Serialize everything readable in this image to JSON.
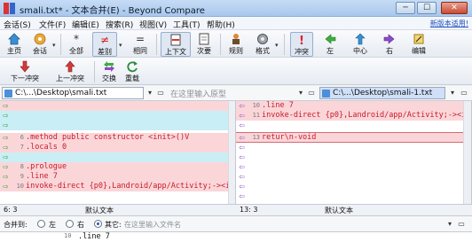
{
  "window": {
    "title": "smali.txt* - 文本合并(E) - Beyond Compare",
    "minimize": "─",
    "maximize": "☐",
    "close": "✕"
  },
  "menu": {
    "items": [
      "会话(S)",
      "文件(F)",
      "编辑(E)",
      "搜索(R)",
      "视图(V)",
      "工具(T)",
      "帮助(H)"
    ],
    "new_version_link": "新版本适用!"
  },
  "toolbar1": {
    "home": "主页",
    "sessions": "会话",
    "all": "全部",
    "diffs": "差别",
    "same": "相同",
    "context": "上下文",
    "minor": "次要",
    "rules": "规则",
    "format": "格式",
    "conflicts": "冲突",
    "left": "左",
    "center": "中心",
    "right": "右",
    "edit": "编辑"
  },
  "toolbar2": {
    "next_conflict": "下一冲突",
    "prev_conflict": "上一冲突",
    "swap": "交换",
    "reload": "重载"
  },
  "paths": {
    "left": "C:\\...\\Desktop\\smali.txt",
    "center_placeholder": "在这里输入原型",
    "right": "C:\\...\\Desktop\\smali-1.txt"
  },
  "left_pane": {
    "rows": [
      {
        "arrow": "⇨",
        "ln": "",
        "code": ""
      },
      {
        "arrow": "⇨",
        "ln": "",
        "code": ""
      },
      {
        "arrow": "⇨",
        "ln": "",
        "code": ""
      },
      {
        "arrow": "⇨",
        "ln": "6",
        "code": ".method public constructor <init>()V"
      },
      {
        "arrow": "⇨",
        "ln": "7",
        "code": ".locals 0"
      },
      {
        "arrow": "⇨",
        "ln": "",
        "code": ""
      },
      {
        "arrow": "⇨",
        "ln": "8",
        "code": ".prologue"
      },
      {
        "arrow": "⇨",
        "ln": "9",
        "code": ".line 7"
      },
      {
        "arrow": "⇨",
        "ln": "10",
        "code": "invoke-direct {p0},Landroid/app/Activity;-><in"
      },
      {
        "arrow": "",
        "ln": "",
        "code": ""
      }
    ]
  },
  "right_pane": {
    "rows": [
      {
        "arrow": "⇦",
        "ln": "10",
        "code": ".line 7"
      },
      {
        "arrow": "⇦",
        "ln": "11",
        "code": "invoke-direct {p0},Landroid/app/Activity;-><ir"
      },
      {
        "arrow": "⇦",
        "ln": "",
        "code": ""
      },
      {
        "arrow": "⇦",
        "ln": "13",
        "code": "retur\\n-void"
      },
      {
        "arrow": "⇦",
        "ln": "",
        "code": ""
      },
      {
        "arrow": "⇦",
        "ln": "",
        "code": ""
      },
      {
        "arrow": "⇦",
        "ln": "",
        "code": ""
      },
      {
        "arrow": "⇦",
        "ln": "",
        "code": ""
      },
      {
        "arrow": "⇦",
        "ln": "",
        "code": ""
      },
      {
        "arrow": "⇦",
        "ln": "",
        "code": ""
      }
    ]
  },
  "status": {
    "left_pos": "6: 3",
    "left_type": "默认文本",
    "right_pos": "13: 3",
    "right_type": "默认文本"
  },
  "merge": {
    "label": "合并到:",
    "opt_left": "左",
    "opt_right": "右",
    "opt_other": "其它:",
    "file_placeholder": "在这里输入文件名"
  },
  "output": {
    "ln": "10",
    "code": ".line 7"
  },
  "colors": {
    "diff_pink": "#fbd6d9",
    "diff_blue": "#c9eef6",
    "conflict_red": "#c51b2a",
    "arrow_green": "#3aa33a",
    "arrow_purple": "#8a4bc8"
  }
}
